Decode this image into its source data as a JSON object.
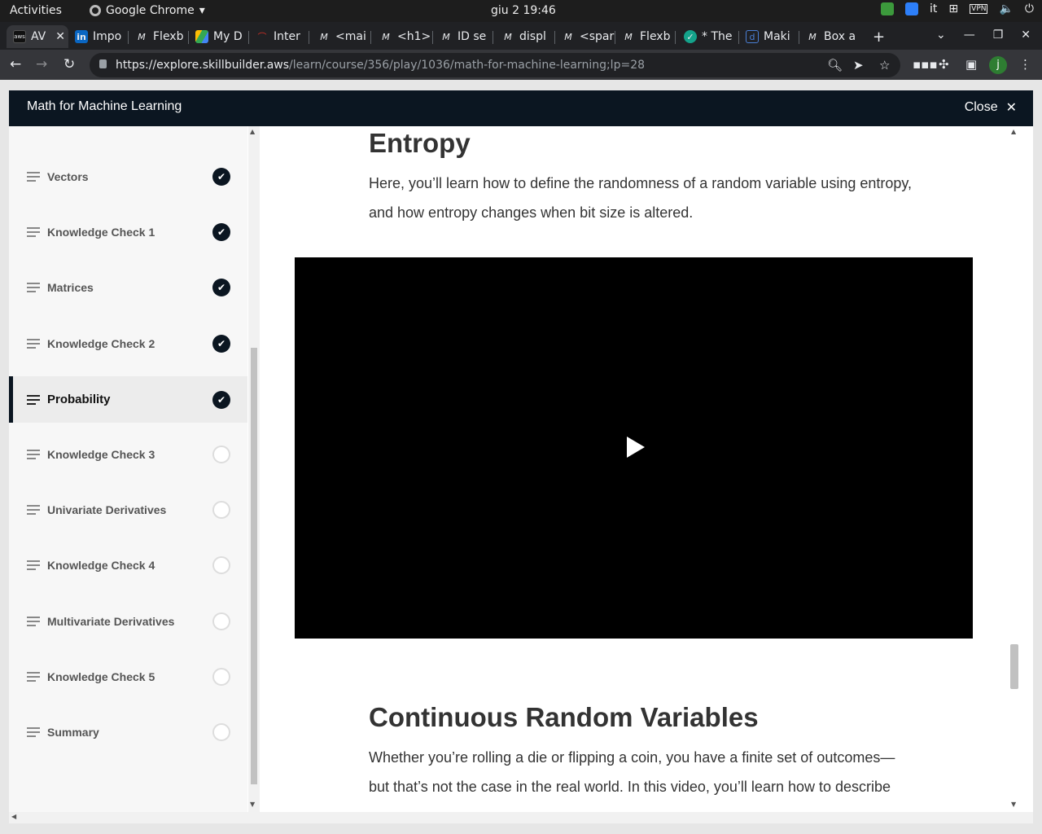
{
  "system_bar": {
    "activities": "Activities",
    "app_name": "Google Chrome",
    "clock": "giu 2  19:46",
    "keyboard_layout": "it"
  },
  "browser": {
    "active_tab": "AV",
    "tabs": [
      "Impo",
      "Flexb",
      "My D",
      "Inter",
      "<mai",
      "<h1>",
      "ID se",
      "displ",
      "<spar",
      "Flexb",
      "* The",
      "Maki",
      "Box a"
    ],
    "url_host": "https://explore.skillbuilder.aws",
    "url_path": "/learn/course/356/play/1036/math-for-machine-learning;lp=28",
    "profile_initial": "j"
  },
  "course": {
    "title": "Math for Machine Learning",
    "close_label": "Close"
  },
  "sidebar": {
    "items": [
      {
        "label": "Vectors",
        "completed": true
      },
      {
        "label": "Knowledge Check 1",
        "completed": true
      },
      {
        "label": "Matrices",
        "completed": true
      },
      {
        "label": "Knowledge Check 2",
        "completed": true
      },
      {
        "label": "Probability",
        "completed": true,
        "current": true
      },
      {
        "label": "Knowledge Check 3",
        "completed": false
      },
      {
        "label": "Univariate Derivatives",
        "completed": false
      },
      {
        "label": "Knowledge Check 4",
        "completed": false
      },
      {
        "label": "Multivariate Derivatives",
        "completed": false
      },
      {
        "label": "Knowledge Check 5",
        "completed": false
      },
      {
        "label": "Summary",
        "completed": false
      }
    ]
  },
  "content": {
    "section1": {
      "heading": "Entropy",
      "body": "Here, you’ll learn how to define the randomness of a random variable using entropy, and how entropy changes when bit size is altered."
    },
    "section2": {
      "heading": "Continuous Random Variables",
      "body": "Whether you’re rolling a die or flipping a coin, you have a finite set of outcomes—but that’s not the case in the real world. In this video, you’ll learn how to describe"
    }
  },
  "colors": {
    "header_bg": "#0b1621",
    "check_bg": "#0b1621",
    "sidebar_bg": "#f7f7f7"
  }
}
